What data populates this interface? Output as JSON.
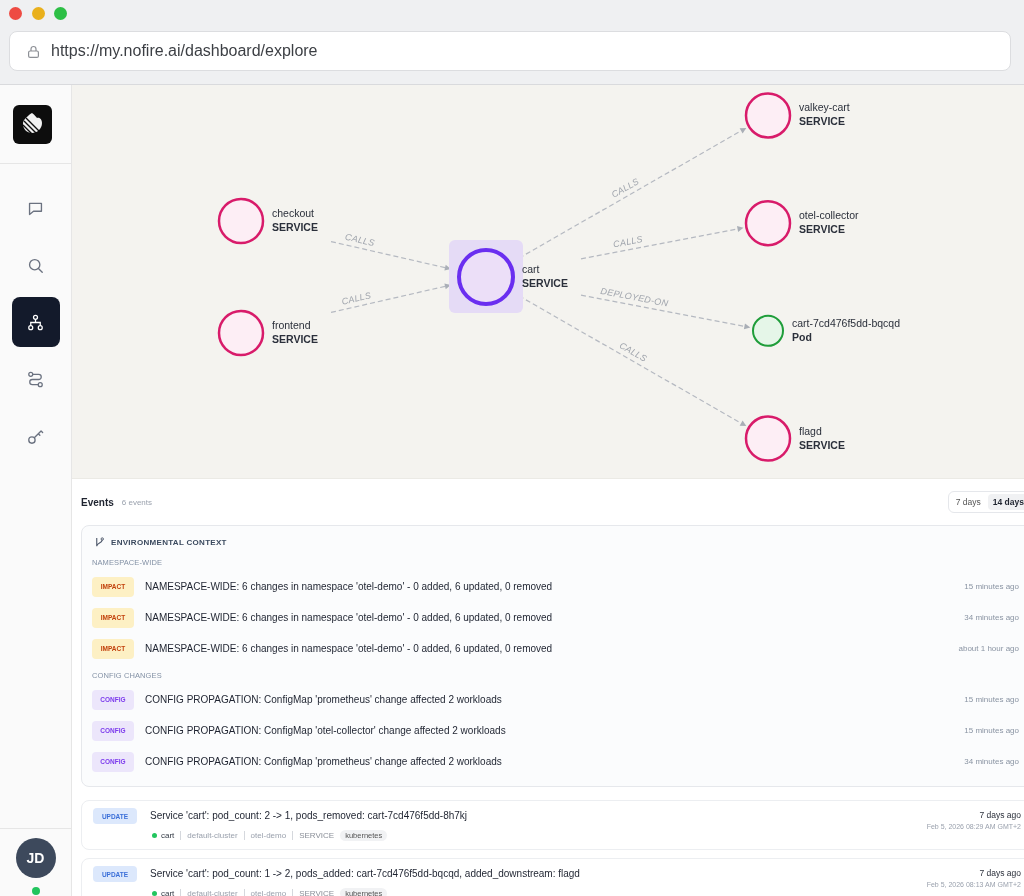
{
  "browser": {
    "url": "https://my.nofire.ai/dashboard/explore"
  },
  "sidebar": {
    "nav_items": [
      {
        "kind": "chat",
        "selected": false
      },
      {
        "kind": "search",
        "selected": false
      },
      {
        "kind": "topology",
        "selected": true
      },
      {
        "kind": "routes",
        "selected": false
      },
      {
        "kind": "keys",
        "selected": false
      }
    ],
    "user": {
      "initials": "JD",
      "online": true
    }
  },
  "graph": {
    "focus": {
      "name": "cart",
      "type": "SERVICE",
      "kind": "service",
      "selected": true
    },
    "upstream": [
      {
        "name": "checkout",
        "type": "SERVICE",
        "kind": "service",
        "selected": false,
        "edge_label": "CALLS"
      },
      {
        "name": "frontend",
        "type": "SERVICE",
        "kind": "service",
        "selected": false,
        "edge_label": "CALLS"
      }
    ],
    "downstream": [
      {
        "name": "valkey-cart",
        "type": "SERVICE",
        "kind": "service",
        "selected": false,
        "edge_label": "CALLS"
      },
      {
        "name": "otel-collector",
        "type": "SERVICE",
        "kind": "service",
        "selected": false,
        "edge_label": "CALLS"
      },
      {
        "name": "cart-7cd476f5dd-bqcqd",
        "type": "Pod",
        "kind": "pod",
        "selected": false,
        "edge_label": "DEPLOYED-ON"
      },
      {
        "name": "flagd",
        "type": "SERVICE",
        "kind": "service",
        "selected": false,
        "edge_label": "CALLS"
      }
    ]
  },
  "events": {
    "title": "Events",
    "count": "6 events",
    "ranges": [
      {
        "label": "7 days",
        "selected": false
      },
      {
        "label": "14 days",
        "selected": true
      }
    ],
    "context": {
      "title": "ENVIRONMENTAL CONTEXT",
      "groups": [
        {
          "label": "NAMESPACE-WIDE",
          "items": [
            {
              "kind": "impact",
              "badge": "IMPACT",
              "message": "NAMESPACE-WIDE: 6 changes in namespace 'otel-demo' - 0 added, 6 updated, 0 removed",
              "time": "15 minutes ago"
            },
            {
              "kind": "impact",
              "badge": "IMPACT",
              "message": "NAMESPACE-WIDE: 6 changes in namespace 'otel-demo' - 0 added, 6 updated, 0 removed",
              "time": "34 minutes ago"
            },
            {
              "kind": "impact",
              "badge": "IMPACT",
              "message": "NAMESPACE-WIDE: 6 changes in namespace 'otel-demo' - 0 added, 6 updated, 0 removed",
              "time": "about 1 hour ago"
            }
          ]
        },
        {
          "label": "CONFIG CHANGES",
          "items": [
            {
              "kind": "config",
              "badge": "CONFIG",
              "message": "CONFIG PROPAGATION: ConfigMap 'prometheus' change affected 2 workloads",
              "time": "15 minutes ago"
            },
            {
              "kind": "config",
              "badge": "CONFIG",
              "message": "CONFIG PROPAGATION: ConfigMap 'otel-collector' change affected 2 workloads",
              "time": "15 minutes ago"
            },
            {
              "kind": "config",
              "badge": "CONFIG",
              "message": "CONFIG PROPAGATION: ConfigMap 'prometheus' change affected 2 workloads",
              "time": "34 minutes ago"
            }
          ]
        }
      ]
    },
    "list": [
      {
        "kind": "update",
        "badge": "UPDATE",
        "title": "Service 'cart': pod_count: 2 -> 1, pods_removed: cart-7cd476f5dd-8h7kj",
        "healthy": true,
        "service": "cart",
        "cluster": "default-cluster",
        "namespace": "otel-demo",
        "type": "SERVICE",
        "tag": "kubernetes",
        "age": "7 days ago",
        "timestamp": "Feb 5, 2026 08:29 AM GMT+2"
      },
      {
        "kind": "update",
        "badge": "UPDATE",
        "title": "Service 'cart': pod_count: 1 -> 2, pods_added: cart-7cd476f5dd-bqcqd, added_downstream: flagd",
        "healthy": true,
        "service": "cart",
        "cluster": "default-cluster",
        "namespace": "otel-demo",
        "type": "SERVICE",
        "tag": "kubernetes",
        "age": "7 days ago",
        "timestamp": "Feb 5, 2026 08:13 AM GMT+2"
      }
    ]
  }
}
